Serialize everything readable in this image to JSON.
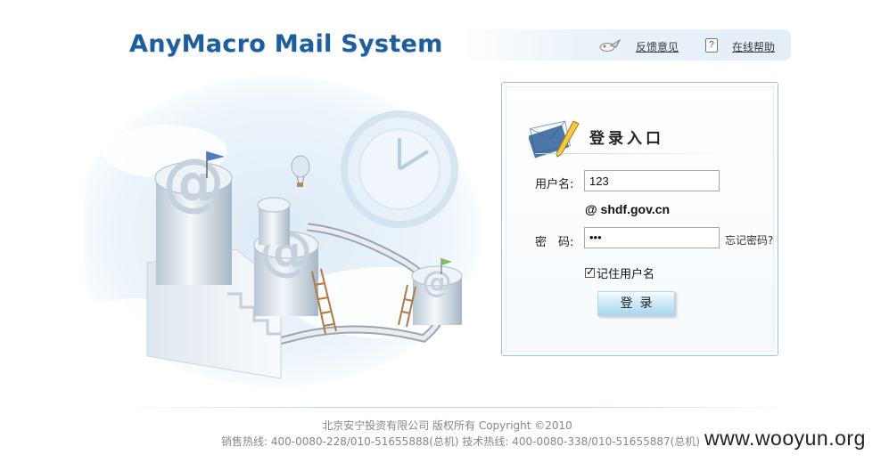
{
  "header": {
    "logo": "AnyMacro Mail System",
    "feedback_link": "反馈意见",
    "help_link": "在线帮助",
    "help_icon_glyph": "?"
  },
  "login": {
    "title": "登录入口",
    "username_label": "用户名:",
    "username_value": "123",
    "domain": "@ shdf.gov.cn",
    "password_label": "密　码:",
    "password_value": "•••",
    "forgot_link": "忘记密码?",
    "remember_label": "记住用户名",
    "remember_checked": true,
    "submit_label": "登录"
  },
  "footer": {
    "line1": "北京安宁投资有限公司  版权所有  Copyright ©2010",
    "line2": "销售热线: 400-0080-228/010-51655888(总机) 技术热线: 400-0080-338/010-51655887(总机)"
  },
  "watermark": "www.wooyun.org",
  "colors": {
    "logo": "#1f5e9c",
    "panel_border": "#9fc4dd",
    "button": "#a9d6ee"
  }
}
